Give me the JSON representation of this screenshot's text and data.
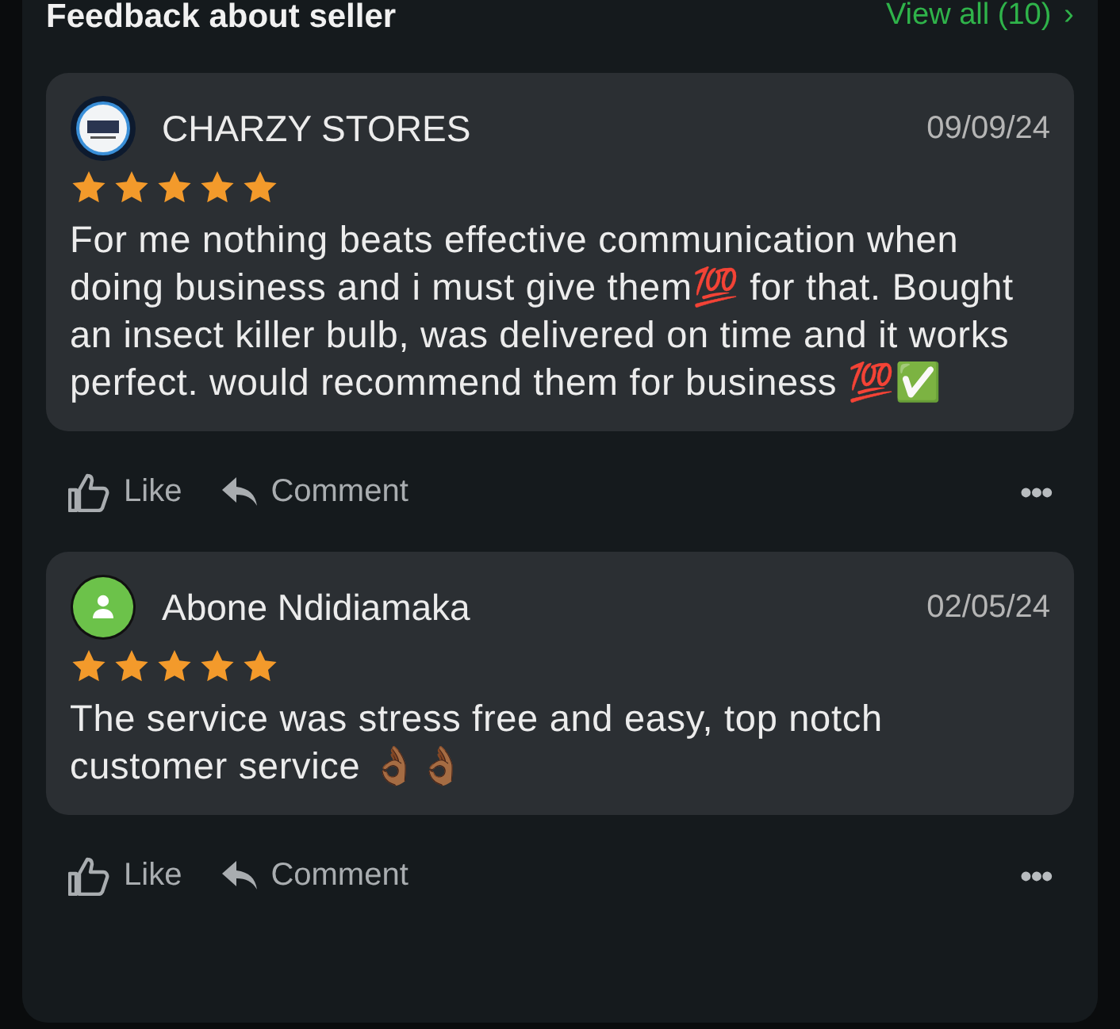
{
  "section": {
    "title": "Feedback about seller",
    "view_all": "View all (10)",
    "chevron": "›"
  },
  "reviews": [
    {
      "author": "CHARZY STORES",
      "kind": "logo",
      "date": "09/09/24",
      "stars": 5,
      "text": "For me nothing beats effective communication when doing business and i must give them💯 for that. Bought an insect killer bulb, was delivered on time and it works perfect. would recommend them for business 💯✅",
      "like": "Like",
      "comment": "Comment",
      "more": "•••"
    },
    {
      "author": "Abone Ndidiamaka",
      "kind": "person",
      "date": "02/05/24",
      "stars": 5,
      "text": "The service was stress free and easy, top notch customer service 👌🏾👌🏾",
      "like": "Like",
      "comment": "Comment",
      "more": "•••"
    }
  ]
}
